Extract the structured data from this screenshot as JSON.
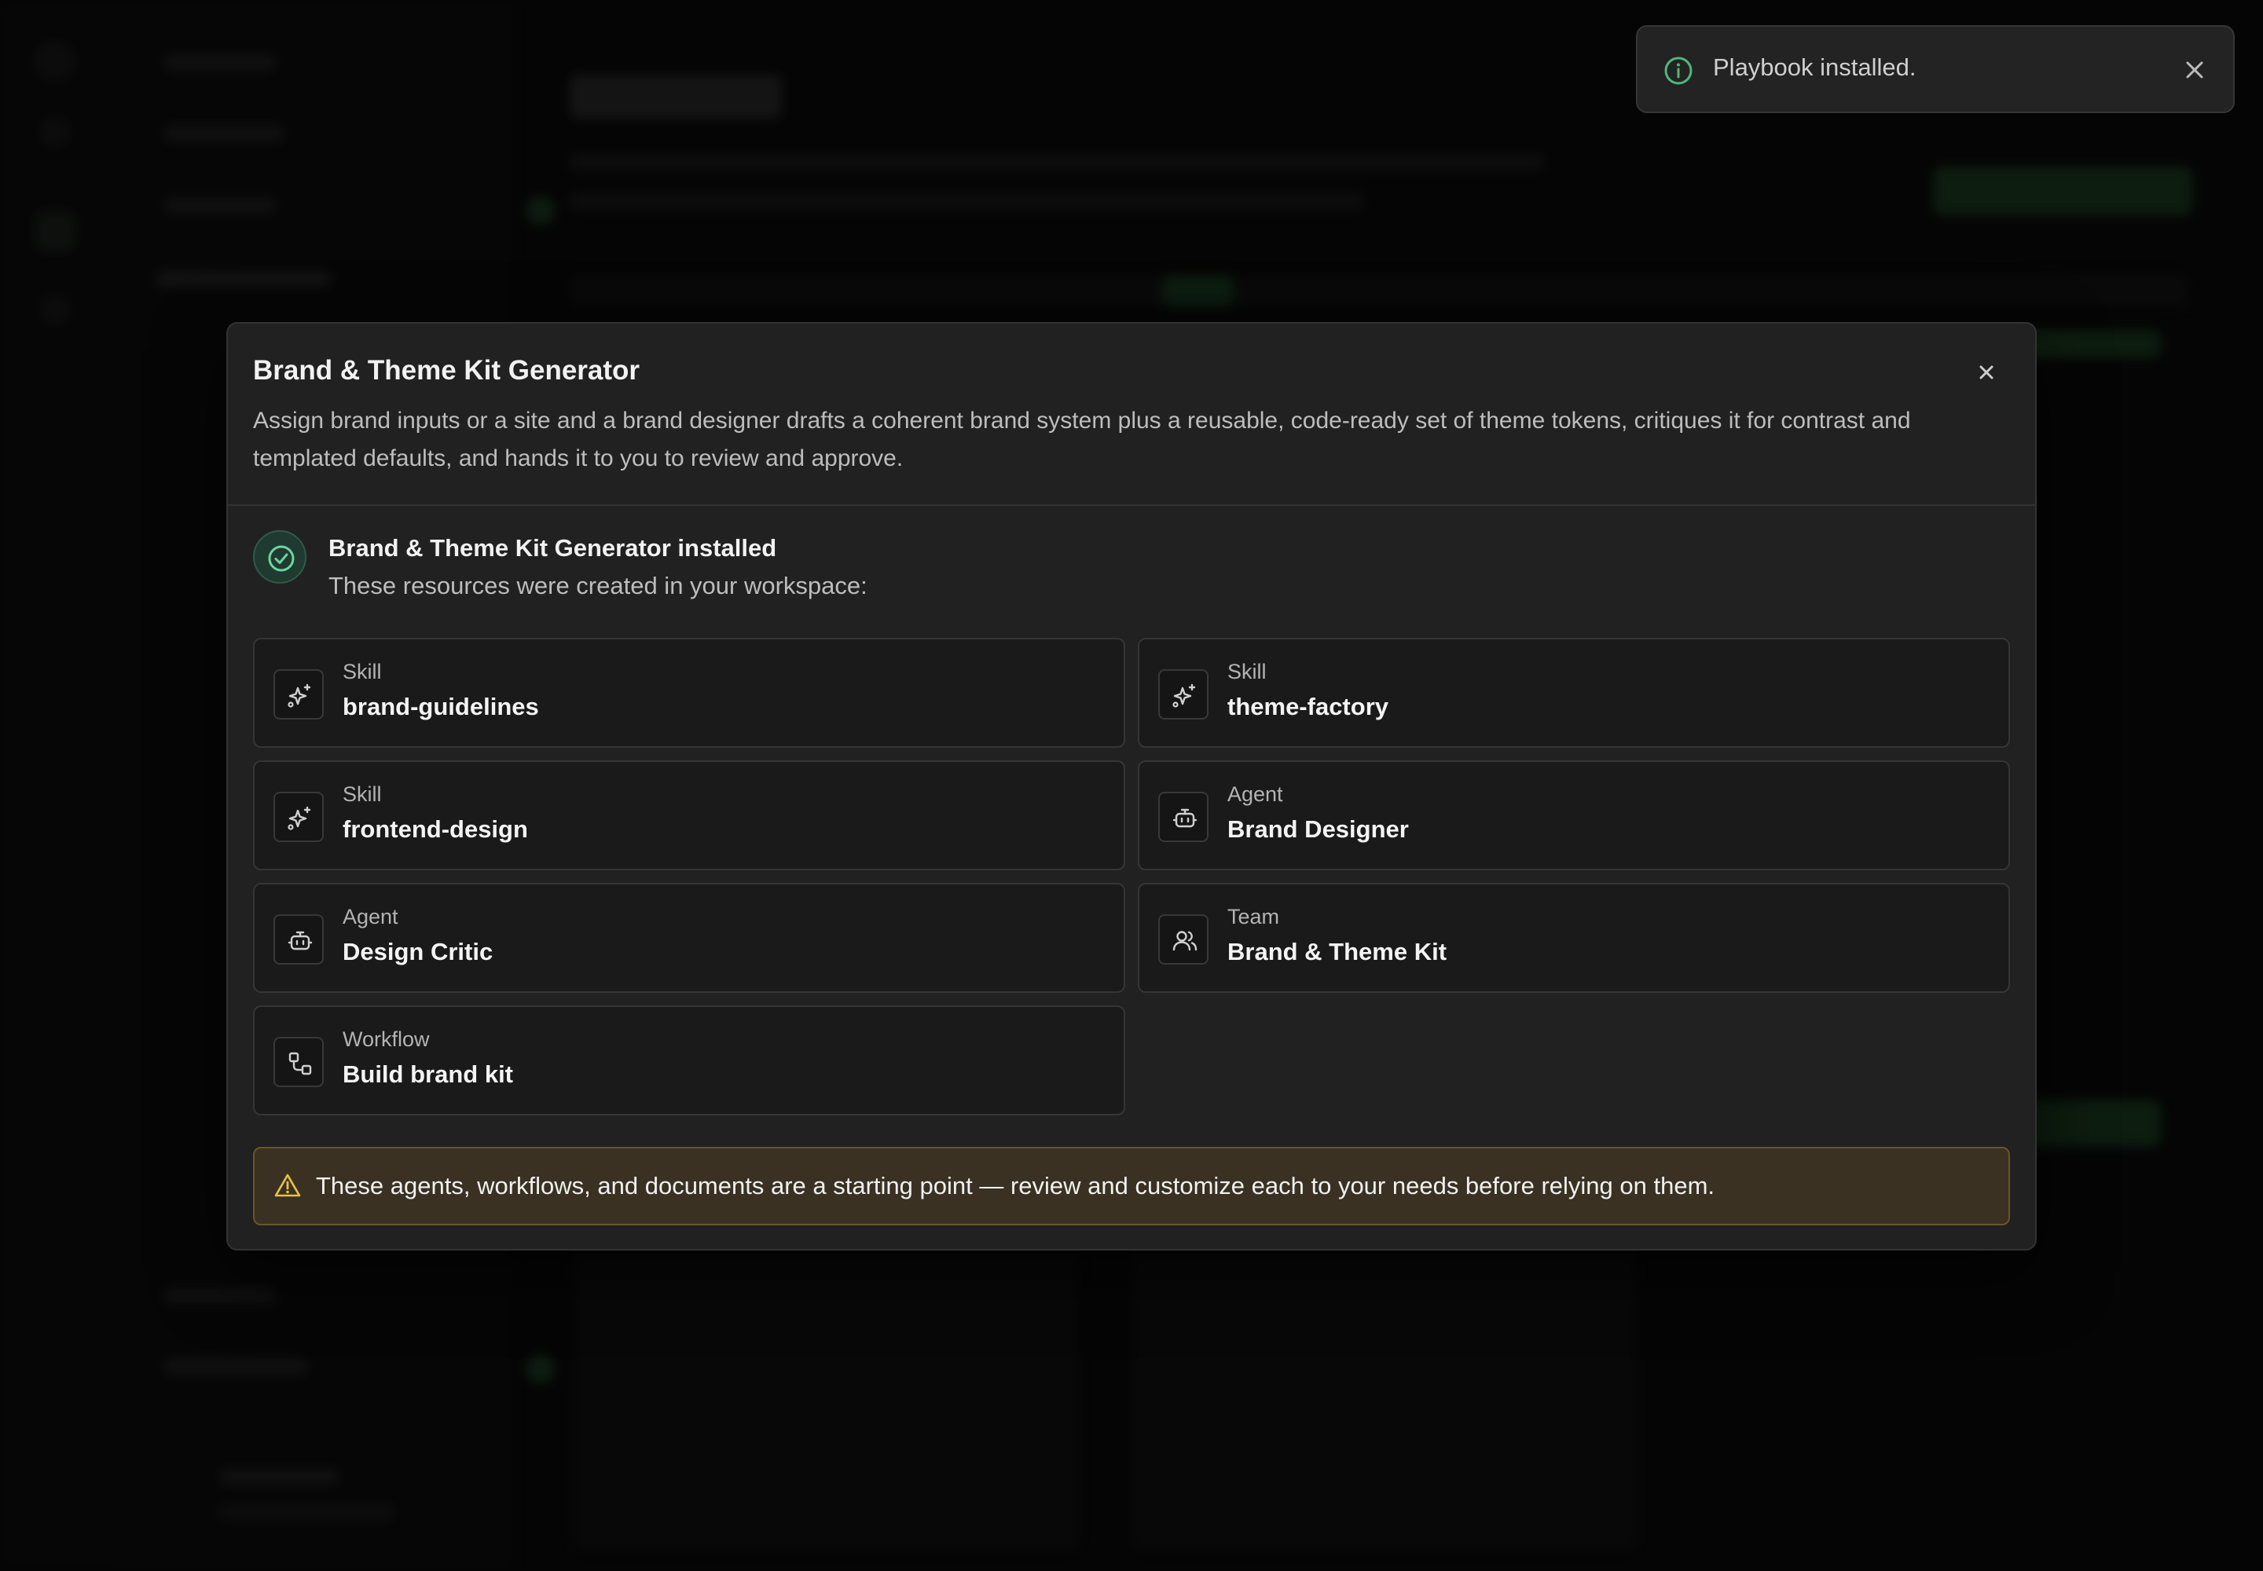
{
  "toast": {
    "message": "Playbook installed.",
    "icon": "info-icon",
    "close_icon": "close-icon"
  },
  "modal": {
    "title": "Brand & Theme Kit Generator",
    "description": "Assign brand inputs or a site and a brand designer drafts a coherent brand system plus a reusable, code-ready set of theme tokens, critiques it for contrast and templated defaults, and hands it to you to review and approve.",
    "status": {
      "title": "Brand & Theme Kit Generator installed",
      "subtitle": "These resources were created in your workspace:"
    },
    "resources": [
      {
        "type": "Skill",
        "name": "brand-guidelines",
        "icon": "sparkle-icon"
      },
      {
        "type": "Skill",
        "name": "theme-factory",
        "icon": "sparkle-icon"
      },
      {
        "type": "Skill",
        "name": "frontend-design",
        "icon": "sparkle-icon"
      },
      {
        "type": "Agent",
        "name": "Brand Designer",
        "icon": "bot-icon"
      },
      {
        "type": "Agent",
        "name": "Design Critic",
        "icon": "bot-icon"
      },
      {
        "type": "Team",
        "name": "Brand & Theme Kit",
        "icon": "users-icon"
      },
      {
        "type": "Workflow",
        "name": "Build brand kit",
        "icon": "workflow-icon"
      }
    ],
    "warning": "These agents, workflows, and documents are a starting point — review and customize each to your needs before relying on them."
  },
  "colors": {
    "success_green": "#4fb87a",
    "warning_yellow": "#e8c24a",
    "warning_bg": "#3a3123",
    "accent_green": "#2b6b37"
  }
}
